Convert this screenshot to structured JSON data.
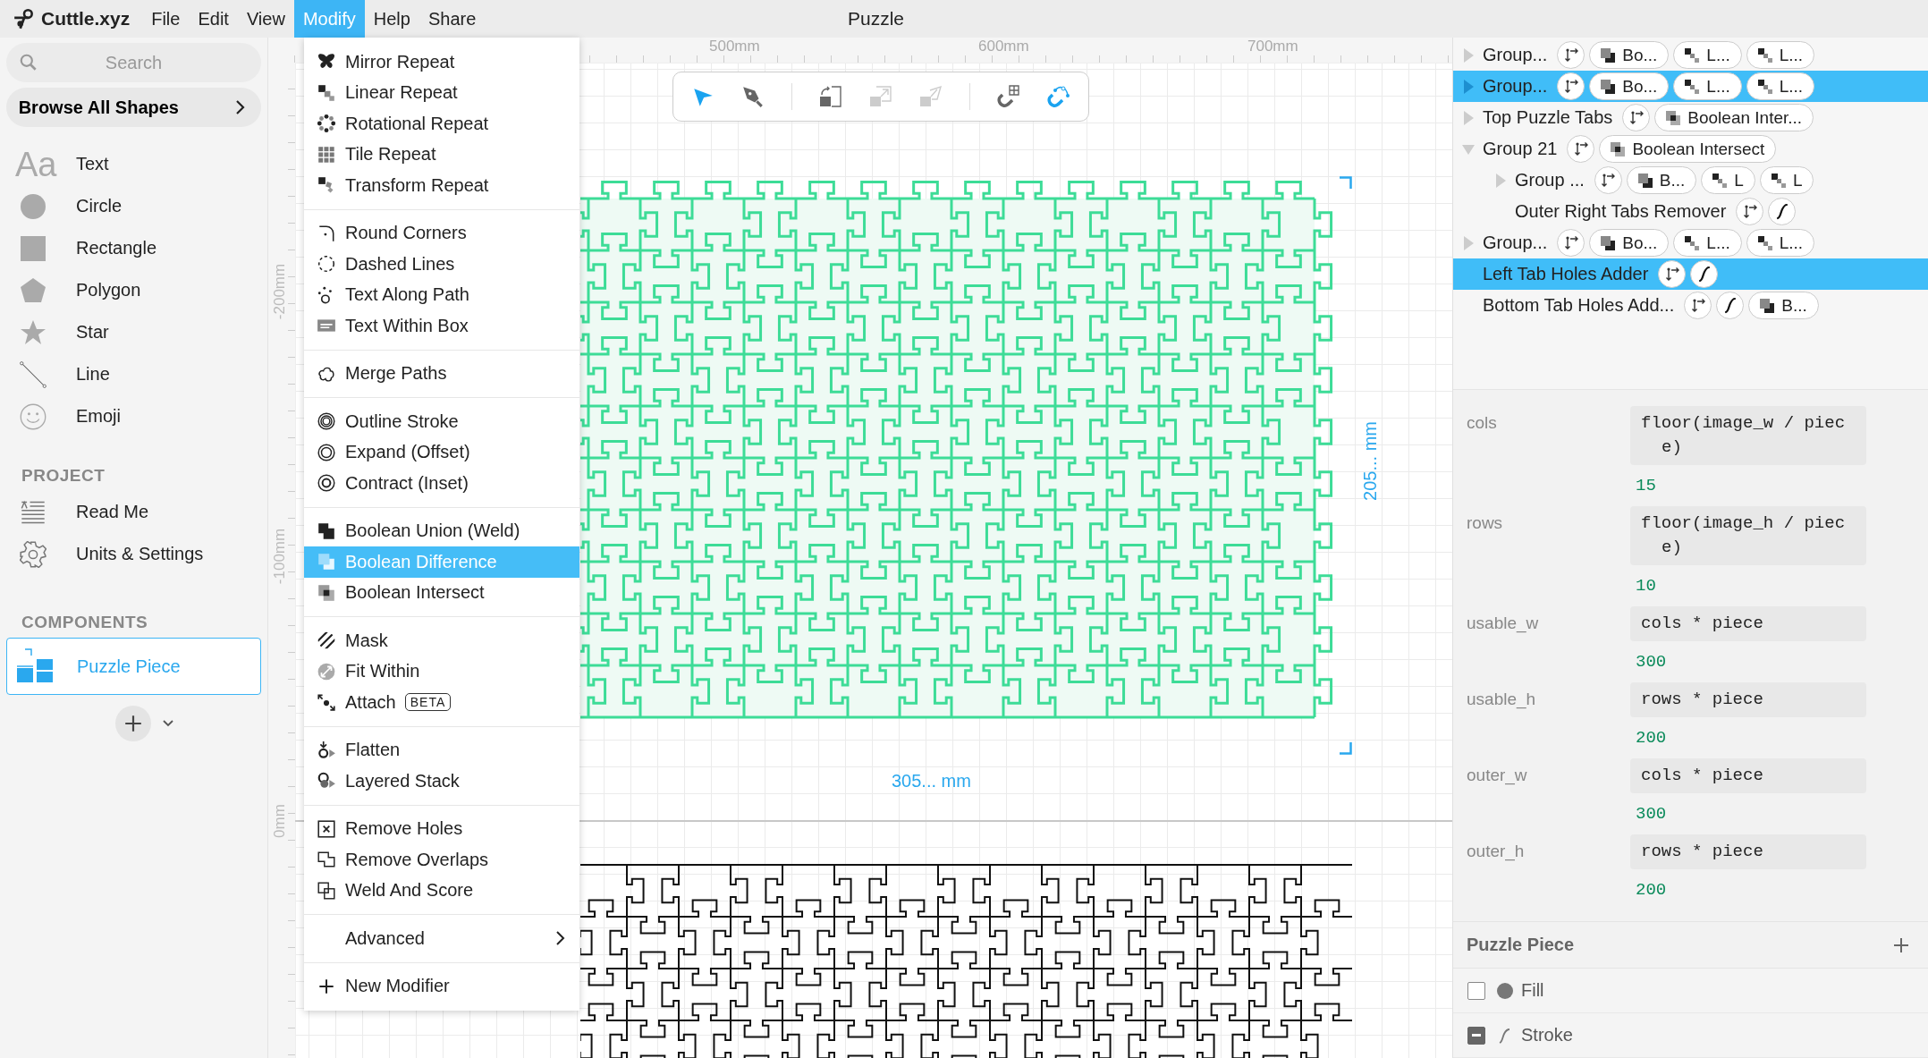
{
  "app": {
    "name": "Cuttle.xyz"
  },
  "menubar": [
    {
      "label": "File",
      "selected": false
    },
    {
      "label": "Edit",
      "selected": false
    },
    {
      "label": "View",
      "selected": false
    },
    {
      "label": "Modify",
      "selected": true
    },
    {
      "label": "Help",
      "selected": false
    },
    {
      "label": "Share",
      "selected": false
    }
  ],
  "document_title": "Puzzle",
  "sidebar": {
    "search": {
      "placeholder": "Search"
    },
    "browse_button": "Browse All Shapes",
    "shapes": [
      {
        "kind": "text",
        "label": "Text",
        "glyph": "Aa"
      },
      {
        "kind": "circle",
        "label": "Circle"
      },
      {
        "kind": "rectangle",
        "label": "Rectangle"
      },
      {
        "kind": "polygon",
        "label": "Polygon"
      },
      {
        "kind": "star",
        "label": "Star"
      },
      {
        "kind": "line",
        "label": "Line"
      },
      {
        "kind": "emoji",
        "label": "Emoji"
      }
    ],
    "project_header": "PROJECT",
    "project_items": [
      {
        "kind": "readme",
        "label": "Read Me"
      },
      {
        "kind": "settings",
        "label": "Units & Settings"
      }
    ],
    "components_header": "COMPONENTS",
    "components": [
      {
        "label": "Puzzle Piece",
        "selected": true
      }
    ]
  },
  "modify_menu": {
    "groups": [
      [
        {
          "kind": "mirror",
          "label": "Mirror Repeat",
          "selected": false
        },
        {
          "kind": "linear",
          "label": "Linear Repeat",
          "selected": false
        },
        {
          "kind": "rotational",
          "label": "Rotational Repeat",
          "selected": false
        },
        {
          "kind": "tile",
          "label": "Tile Repeat",
          "selected": false
        },
        {
          "kind": "transform",
          "label": "Transform Repeat",
          "selected": false
        }
      ],
      [
        {
          "kind": "round",
          "label": "Round Corners",
          "selected": false
        },
        {
          "kind": "dashed",
          "label": "Dashed Lines",
          "selected": false
        },
        {
          "kind": "textpath",
          "label": "Text Along Path",
          "selected": false
        },
        {
          "kind": "textbox",
          "label": "Text Within Box",
          "selected": false
        }
      ],
      [
        {
          "kind": "merge",
          "label": "Merge Paths",
          "selected": false
        }
      ],
      [
        {
          "kind": "outline",
          "label": "Outline Stroke",
          "selected": false
        },
        {
          "kind": "expand",
          "label": "Expand (Offset)",
          "selected": false
        },
        {
          "kind": "contract",
          "label": "Contract (Inset)",
          "selected": false
        }
      ],
      [
        {
          "kind": "union",
          "label": "Boolean Union (Weld)",
          "selected": false
        },
        {
          "kind": "difference",
          "label": "Boolean Difference",
          "selected": true
        },
        {
          "kind": "intersect",
          "label": "Boolean Intersect",
          "selected": false
        }
      ],
      [
        {
          "kind": "mask",
          "label": "Mask",
          "selected": false
        },
        {
          "kind": "fit",
          "label": "Fit Within",
          "selected": false
        },
        {
          "kind": "attach",
          "label": "Attach",
          "selected": false,
          "badge": "BETA"
        }
      ],
      [
        {
          "kind": "flatten",
          "label": "Flatten",
          "selected": false
        },
        {
          "kind": "layered",
          "label": "Layered Stack",
          "selected": false
        }
      ],
      [
        {
          "kind": "removeholes",
          "label": "Remove Holes",
          "selected": false
        },
        {
          "kind": "removeoverlaps",
          "label": "Remove Overlaps",
          "selected": false
        },
        {
          "kind": "weld",
          "label": "Weld And Score",
          "selected": false
        }
      ],
      [
        {
          "kind": "submenu",
          "label": "Advanced",
          "selected": false
        }
      ],
      [
        {
          "kind": "plus",
          "label": "New Modifier",
          "selected": false
        }
      ]
    ]
  },
  "toolbar": {
    "tools": [
      {
        "kind": "select",
        "selected": true
      },
      {
        "kind": "pen",
        "selected": false
      }
    ],
    "actions": [
      {
        "kind": "rotate",
        "disabled": false
      },
      {
        "kind": "scale",
        "disabled": true
      },
      {
        "kind": "skew",
        "disabled": true
      }
    ],
    "snapping": [
      {
        "kind": "grid",
        "on": false
      },
      {
        "kind": "geometry",
        "on": true
      }
    ]
  },
  "canvas": {
    "ruler_x": [
      "500mm",
      "600mm",
      "700mm"
    ],
    "ruler_y": [
      "-200mm",
      "-100mm",
      "0mm"
    ],
    "width_label": "305... mm",
    "height_label": "205... mm"
  },
  "layers": [
    {
      "label": "Group...",
      "expanded": false,
      "selected": false,
      "chips": [
        {
          "kind": "transform"
        },
        {
          "kind": "difference",
          "label": "Bo..."
        },
        {
          "kind": "linear",
          "label": "L..."
        },
        {
          "kind": "linear",
          "label": "L..."
        }
      ]
    },
    {
      "label": "Group...",
      "expanded": false,
      "selected": true,
      "chips": [
        {
          "kind": "transform"
        },
        {
          "kind": "difference",
          "label": "Bo..."
        },
        {
          "kind": "linear",
          "label": "L..."
        },
        {
          "kind": "linear",
          "label": "L..."
        }
      ]
    },
    {
      "label": "Top Puzzle Tabs",
      "expanded": false,
      "selected": false,
      "chips": [
        {
          "kind": "transform"
        },
        {
          "kind": "intersect",
          "label": "Boolean Inter..."
        }
      ]
    },
    {
      "label": "Group 21",
      "expanded": true,
      "selected": false,
      "chips": [
        {
          "kind": "transform"
        },
        {
          "kind": "intersect",
          "label": "Boolean Intersect"
        }
      ],
      "children": [
        {
          "label": "Group ...",
          "expanded": false,
          "selected": false,
          "chips": [
            {
              "kind": "transform"
            },
            {
              "kind": "difference",
              "label": "B..."
            },
            {
              "kind": "linear",
              "label": "L"
            },
            {
              "kind": "linear",
              "label": "L"
            }
          ]
        },
        {
          "label": "Outer Right Tabs Remover",
          "selected": false,
          "chips": [
            {
              "kind": "transform"
            },
            {
              "kind": "script"
            }
          ]
        }
      ]
    },
    {
      "label": "Group...",
      "expanded": false,
      "selected": false,
      "chips": [
        {
          "kind": "transform"
        },
        {
          "kind": "difference",
          "label": "Bo..."
        },
        {
          "kind": "linear",
          "label": "L..."
        },
        {
          "kind": "linear",
          "label": "L..."
        }
      ]
    },
    {
      "label": "Left Tab Holes Adder",
      "selected": true,
      "chips": [
        {
          "kind": "transform"
        },
        {
          "kind": "script"
        }
      ]
    },
    {
      "label": "Bottom Tab Holes Add...",
      "selected": false,
      "chips": [
        {
          "kind": "transform"
        },
        {
          "kind": "script"
        },
        {
          "kind": "difference",
          "label": "B..."
        }
      ]
    }
  ],
  "parameters": [
    {
      "name": "cols",
      "expression": "floor(image_w / piece)",
      "value": "15"
    },
    {
      "name": "rows",
      "expression": "floor(image_h / piece)",
      "value": "10"
    },
    {
      "name": "usable_w",
      "expression": "cols * piece",
      "value": "300"
    },
    {
      "name": "usable_h",
      "expression": "rows * piece",
      "value": "200"
    },
    {
      "name": "outer_w",
      "expression": "cols * piece",
      "value": "300"
    },
    {
      "name": "outer_h",
      "expression": "rows * piece",
      "value": "200"
    }
  ],
  "component_panel": {
    "title": "Puzzle Piece",
    "styles": [
      {
        "kind": "fill",
        "label": "Fill",
        "mixed": false
      },
      {
        "kind": "stroke",
        "label": "Stroke",
        "mixed": true
      }
    ]
  }
}
